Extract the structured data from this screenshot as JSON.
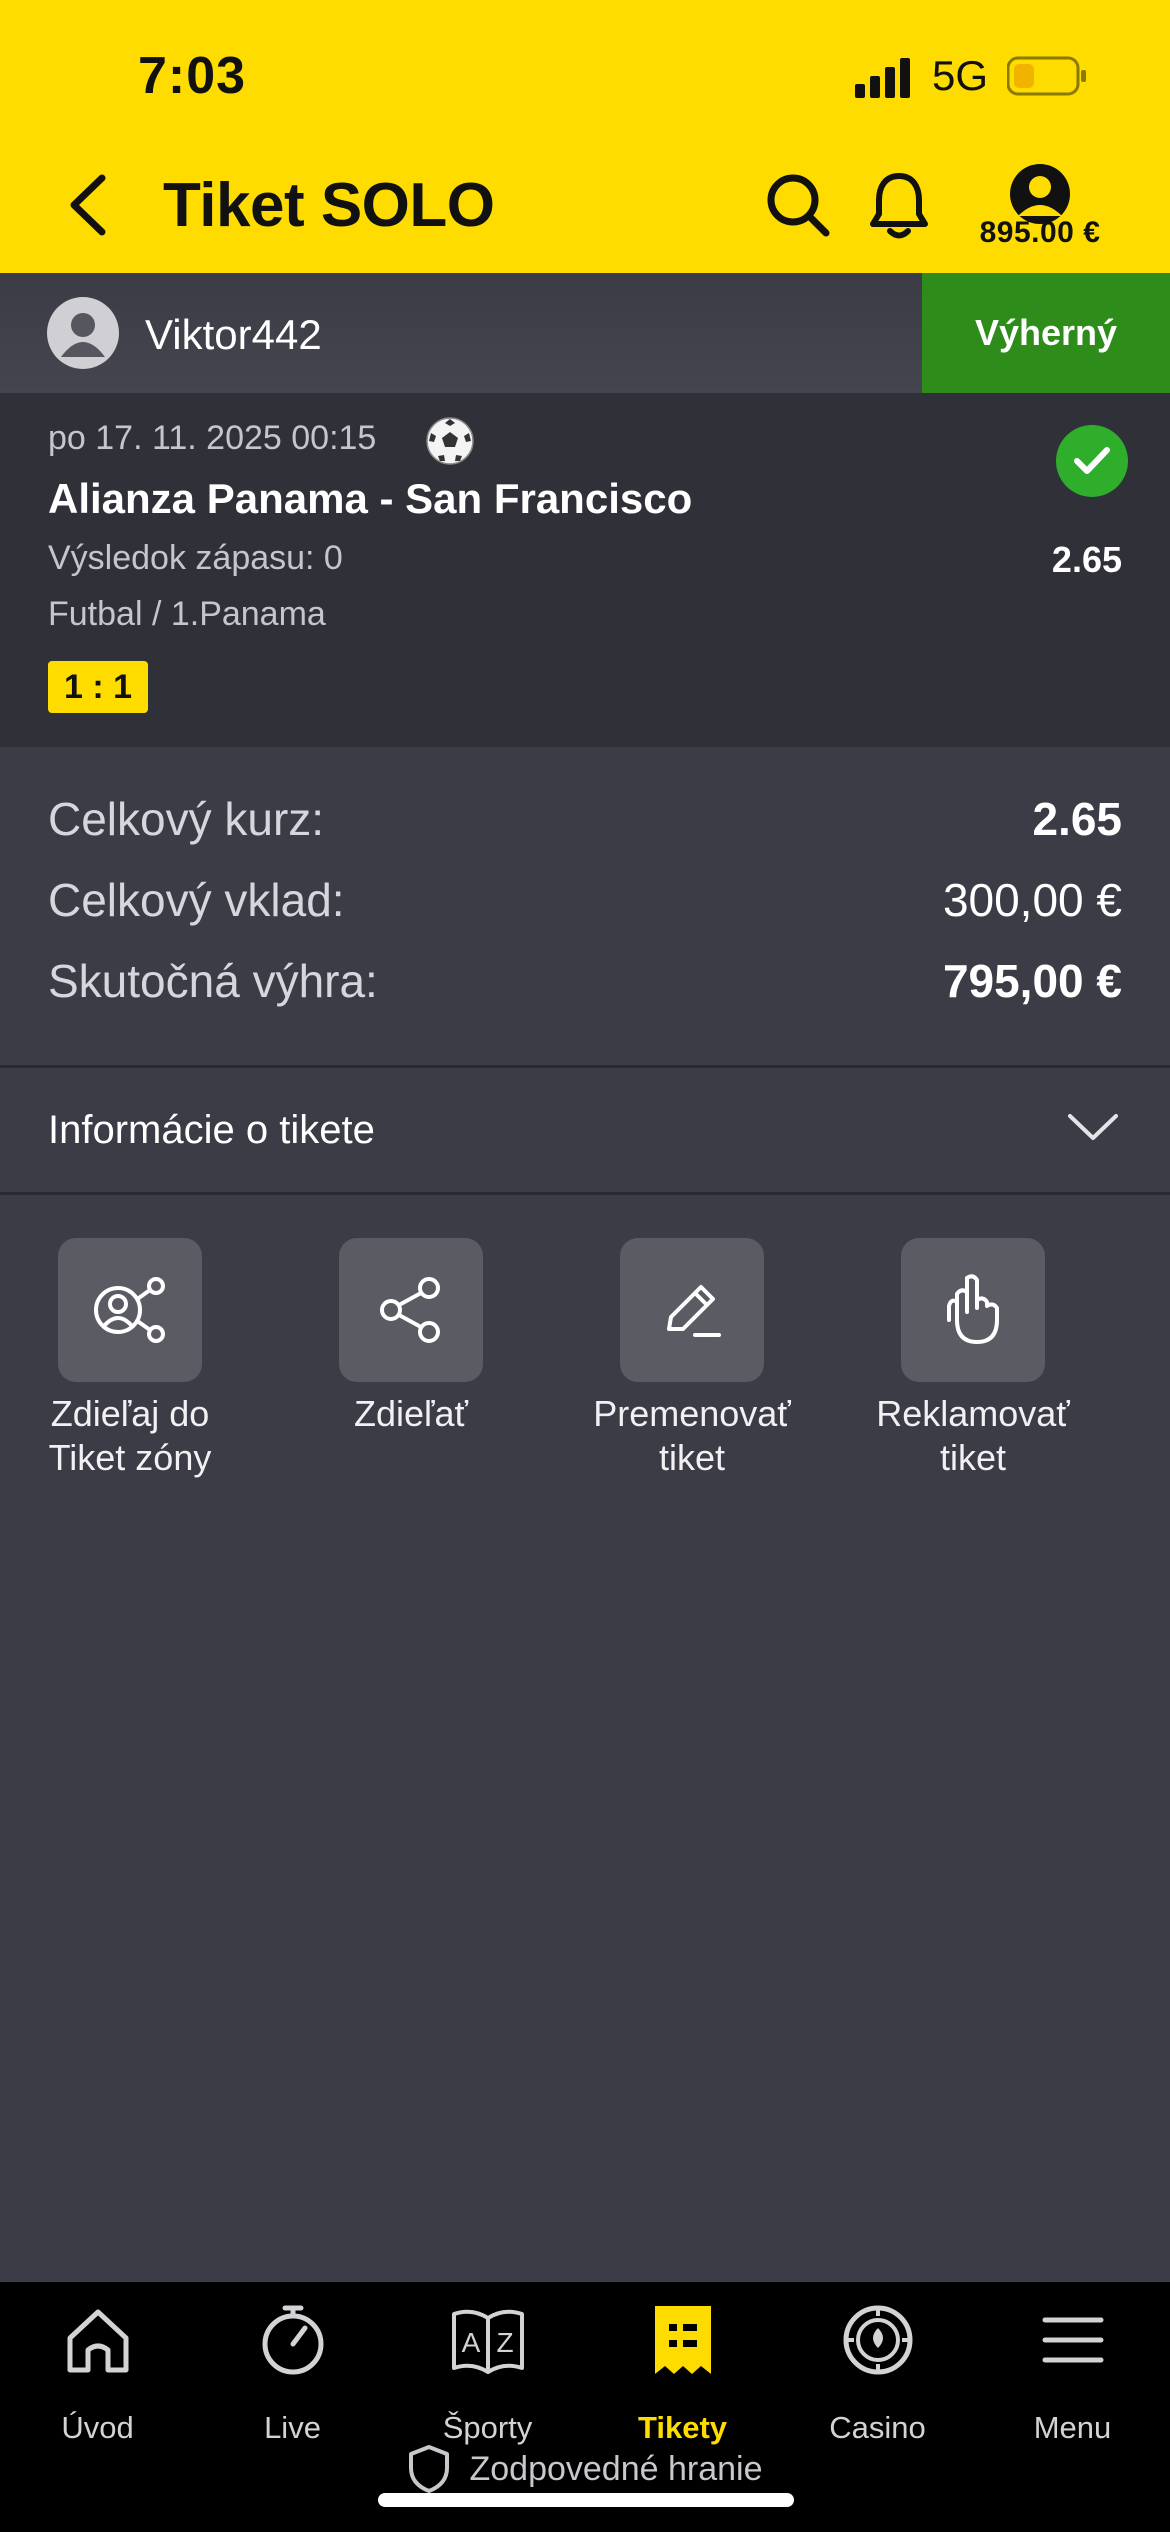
{
  "status_bar": {
    "time": "7:03",
    "network": "5G",
    "battery_level": 0.25
  },
  "header": {
    "title": "Tiket SOLO",
    "balance": "895.00 €"
  },
  "user": {
    "name": "Viktor442",
    "status": "Výherný"
  },
  "event": {
    "date": "po 17. 11. 2025 00:15",
    "name": "Alianza Panama - San Francisco",
    "market": "Výsledok zápasu: 0",
    "odds": "2.65",
    "league": "Futbal / 1.Panama",
    "score": "1 : 1"
  },
  "summary": {
    "total_odds_label": "Celkový kurz:",
    "total_odds": "2.65",
    "total_stake_label": "Celkový vklad:",
    "total_stake": "300,00 €",
    "actual_win_label": "Skutočná výhra:",
    "actual_win": "795,00 €"
  },
  "info": {
    "label": "Informácie o tikete"
  },
  "actions": [
    {
      "label_line1": "Zdieľaj do",
      "label_line2": "Tiket zóny",
      "icon": "share-zone-icon"
    },
    {
      "label_line1": "Zdieľať",
      "label_line2": "",
      "icon": "share-icon"
    },
    {
      "label_line1": "Premenovať",
      "label_line2": "tiket",
      "icon": "pencil-icon"
    },
    {
      "label_line1": "Reklamovať",
      "label_line2": "tiket",
      "icon": "hand-icon"
    }
  ],
  "nav": [
    {
      "label": "Úvod",
      "icon": "home-icon"
    },
    {
      "label": "Live",
      "icon": "stopwatch-icon"
    },
    {
      "label": "Športy",
      "icon": "az-book-icon"
    },
    {
      "label": "Tikety",
      "icon": "ticket-icon",
      "active": true
    },
    {
      "label": "Casino",
      "icon": "casino-chip-icon"
    },
    {
      "label": "Menu",
      "icon": "hamburger-icon"
    }
  ],
  "footer": {
    "responsible": "Zodpovedné hranie"
  },
  "colors": {
    "accent": "#ffdc00",
    "win_green": "#2e8c1a",
    "background": "#3b3c45"
  }
}
